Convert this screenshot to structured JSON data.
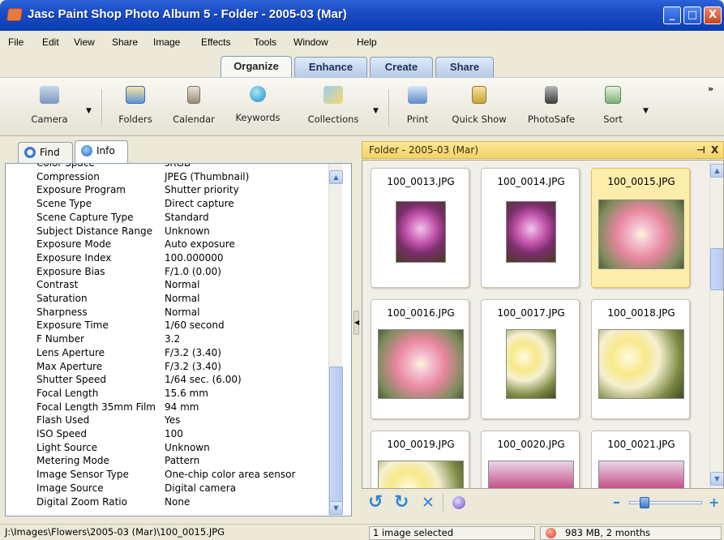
{
  "window": {
    "title": "Jasc Paint Shop Photo Album 5 - Folder - 2005-03 (Mar)",
    "controls": {
      "minimize": "_",
      "maximize": "□",
      "close": "X"
    }
  },
  "menu": [
    "File",
    "Edit",
    "View",
    "Share",
    "Image",
    "Effects",
    "Tools",
    "Window",
    "Help"
  ],
  "top_tabs": [
    {
      "label": "Organize",
      "active": true
    },
    {
      "label": "Enhance",
      "active": false
    },
    {
      "label": "Create",
      "active": false
    },
    {
      "label": "Share",
      "active": false
    }
  ],
  "toolbar": {
    "camera": "Camera",
    "folders": "Folders",
    "calendar": "Calendar",
    "keywords": "Keywords",
    "collections": "Collections",
    "print": "Print",
    "quick_show": "Quick Show",
    "photosafe": "PhotoSafe",
    "sort": "Sort",
    "more": "»",
    "dropdown_glyph": "▼"
  },
  "left_tabs": [
    {
      "label": "Find",
      "active": false
    },
    {
      "label": "Info",
      "active": true
    }
  ],
  "info_rows": [
    {
      "key": "Color Space",
      "value": "sRGB"
    },
    {
      "key": "Compression",
      "value": "JPEG (Thumbnail)"
    },
    {
      "key": "Exposure Program",
      "value": "Shutter priority"
    },
    {
      "key": "Scene Type",
      "value": "Direct capture"
    },
    {
      "key": "Scene Capture Type",
      "value": "Standard"
    },
    {
      "key": "Subject Distance Range",
      "value": "Unknown"
    },
    {
      "key": "Exposure Mode",
      "value": "Auto exposure"
    },
    {
      "key": "Exposure Index",
      "value": "100.000000"
    },
    {
      "key": "Exposure Bias",
      "value": "F/1.0 (0.00)"
    },
    {
      "key": "Contrast",
      "value": "Normal"
    },
    {
      "key": "Saturation",
      "value": "Normal"
    },
    {
      "key": "Sharpness",
      "value": "Normal"
    },
    {
      "key": "Exposure Time",
      "value": "1/60 second"
    },
    {
      "key": "F Number",
      "value": "3.2"
    },
    {
      "key": "Lens Aperture",
      "value": "F/3.2 (3.40)"
    },
    {
      "key": "Max Aperture",
      "value": "F/3.2 (3.40)"
    },
    {
      "key": "Shutter Speed",
      "value": "1/64 sec. (6.00)"
    },
    {
      "key": "Focal Length",
      "value": "15.6 mm"
    },
    {
      "key": "Focal Length 35mm Film",
      "value": "94 mm"
    },
    {
      "key": "Flash Used",
      "value": "Yes"
    },
    {
      "key": "ISO Speed",
      "value": "100"
    },
    {
      "key": "Light Source",
      "value": "Unknown"
    },
    {
      "key": "Metering Mode",
      "value": "Pattern"
    },
    {
      "key": "Image Sensor Type",
      "value": "One-chip color area sensor"
    },
    {
      "key": "Image Source",
      "value": "Digital camera"
    },
    {
      "key": "Digital Zoom Ratio",
      "value": "None"
    }
  ],
  "folder_panel": {
    "title": "Folder - 2005-03 (Mar)",
    "pin": "⊣",
    "close": "X"
  },
  "thumbnails": [
    {
      "name": "100_0013.JPG",
      "selected": false,
      "kind": "magenta"
    },
    {
      "name": "100_0014.JPG",
      "selected": false,
      "kind": "magenta"
    },
    {
      "name": "100_0015.JPG",
      "selected": true,
      "kind": "pink"
    },
    {
      "name": "100_0016.JPG",
      "selected": false,
      "kind": "pink"
    },
    {
      "name": "100_0017.JPG",
      "selected": false,
      "kind": "yellow"
    },
    {
      "name": "100_0018.JPG",
      "selected": false,
      "kind": "yellow"
    },
    {
      "name": "100_0019.JPG",
      "selected": false,
      "kind": "yellow"
    },
    {
      "name": "100_0020.JPG",
      "selected": false,
      "kind": "mixed"
    },
    {
      "name": "100_0021.JPG",
      "selected": false,
      "kind": "mixed"
    }
  ],
  "bottom_tools": {
    "rotate_left": "↺",
    "rotate_right": "↻",
    "delete": "✕",
    "zoom_out": "–",
    "zoom_in": "+"
  },
  "zoom_level": 0.15,
  "status": {
    "path": "J:\\Images\\Flowers\\2005-03 (Mar)\\100_0015.JPG",
    "selection": "1 image selected",
    "backup": "983 MB, 2 months"
  }
}
